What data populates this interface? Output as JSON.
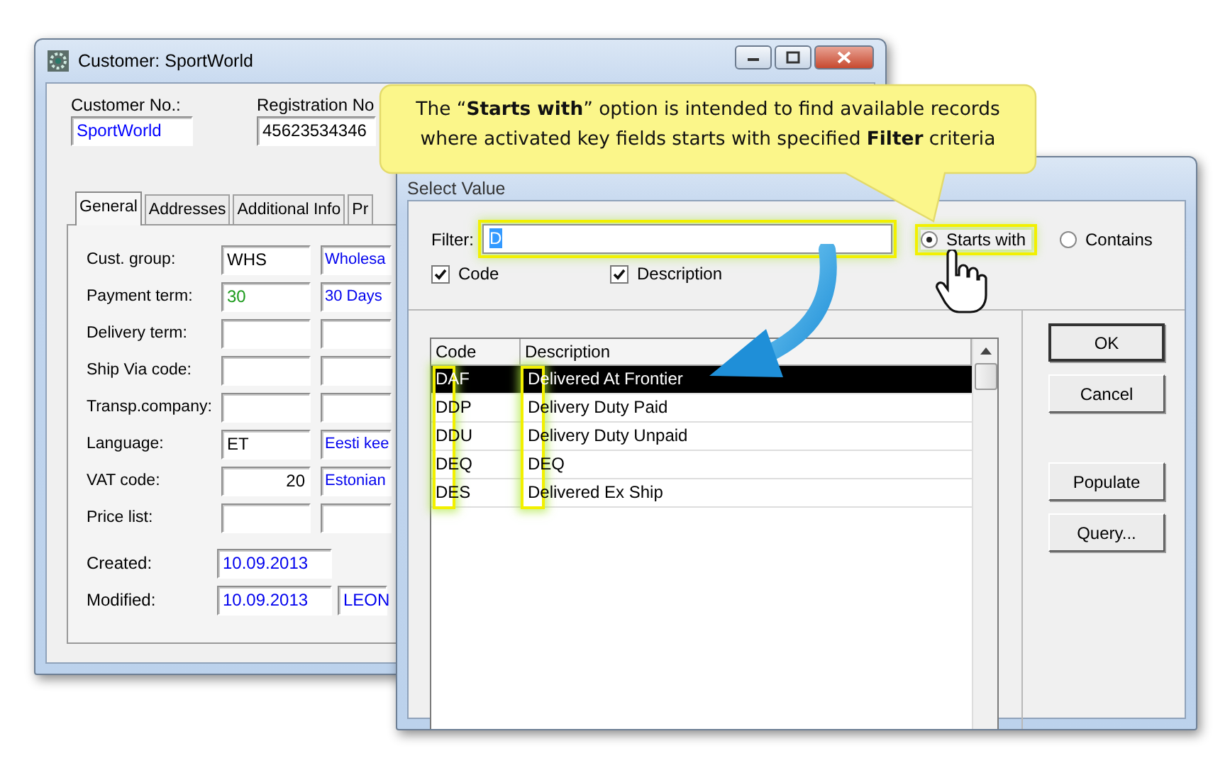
{
  "customer_window": {
    "title": "Customer: SportWorld",
    "header_fields": [
      {
        "label": "Customer No.:",
        "value": "SportWorld",
        "color": "#0000ff"
      },
      {
        "label": "Registration No",
        "value": "45623534346",
        "color": "#000000"
      }
    ],
    "tabs": [
      {
        "label": "General",
        "selected": true
      },
      {
        "label": "Addresses",
        "selected": false
      },
      {
        "label": "Additional Info",
        "selected": false
      },
      {
        "label": "Pr",
        "selected": false
      }
    ],
    "rows": [
      {
        "label": "Cust. group:",
        "value": "WHS",
        "color": "#000000",
        "kind": "text",
        "value_2": "Wholesa"
      },
      {
        "label": "Payment term:",
        "value": "30",
        "color": "#1a9a1a",
        "kind": "text",
        "value_2": "30 Days"
      },
      {
        "label": "Delivery term:",
        "kind": "text"
      },
      {
        "label": "Ship Via code:",
        "kind": "text"
      },
      {
        "label": "Transp.company:",
        "kind": "text"
      },
      {
        "label": "Language:",
        "value": "ET",
        "color": "#000000",
        "kind": "text",
        "value_2": "Eesti kee"
      },
      {
        "label": "VAT code:",
        "value": "20",
        "color": "#000000",
        "kind": "number",
        "value_2": "Estonian"
      },
      {
        "label": "Price list:",
        "kind": "text"
      }
    ],
    "dates": [
      {
        "label": "Created:",
        "value": "10.09.2013"
      },
      {
        "label": "Modified:",
        "value": "10.09.2013",
        "user": "LEON"
      }
    ]
  },
  "select_dialog": {
    "title": "Select Value",
    "filter": {
      "label": "Filter:",
      "value": "D"
    },
    "match_options": [
      {
        "label": "Starts with",
        "selected": true
      },
      {
        "label": "Contains",
        "selected": false
      }
    ],
    "key_fields": [
      {
        "label": "Code",
        "checked": true
      },
      {
        "label": "Description",
        "checked": true
      }
    ],
    "table": {
      "columns": [
        "Code",
        "Description"
      ],
      "rows": [
        {
          "code": "DAF",
          "description": "Delivered At Frontier",
          "selected": true
        },
        {
          "code": "DDP",
          "description": "Delivery Duty Paid",
          "selected": false
        },
        {
          "code": "DDU",
          "description": "Delivery Duty Unpaid",
          "selected": false
        },
        {
          "code": "DEQ",
          "description": "DEQ",
          "selected": false
        },
        {
          "code": "DES",
          "description": "Delivered Ex Ship",
          "selected": false
        }
      ]
    },
    "buttons": [
      "OK",
      "Cancel",
      "Populate",
      "Query..."
    ]
  },
  "callout": {
    "text": "The “**Starts with**” option is intended to find available records where activated key fields starts with specified **Filter** criteria"
  }
}
